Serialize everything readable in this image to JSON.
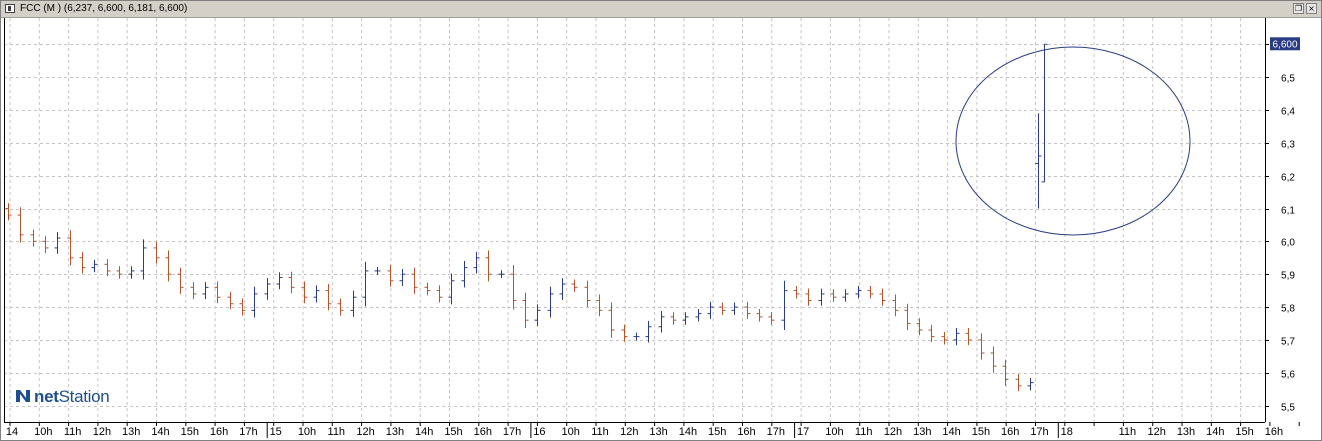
{
  "window": {
    "title": "FCC (M ) (6,237, 6,600, 6,181, 6,600)",
    "restore_glyph": "❐",
    "close_glyph": "×"
  },
  "logo": {
    "prefix": "net",
    "suffix": "Station",
    "icon": "netstation-logo-icon"
  },
  "colors": {
    "up": "#2a3d84",
    "down": "#b4562e",
    "grid": "#c4c4c4",
    "ellipse": "#2a3d84",
    "price_box": "#2a3d84"
  },
  "chart_data": {
    "type": "ohlc",
    "title": "",
    "xlabel": "",
    "ylabel": "",
    "ylim": [
      5.45,
      6.68
    ],
    "y_ticks": [
      "5,5",
      "5,6",
      "5,7",
      "5,8",
      "5,9",
      "6,0",
      "6,1",
      "6,2",
      "6,3",
      "6,4",
      "6,5",
      "6,6"
    ],
    "y_tick_values": [
      5.5,
      5.6,
      5.7,
      5.8,
      5.9,
      6.0,
      6.1,
      6.2,
      6.3,
      6.4,
      6.5,
      6.6
    ],
    "grid": true,
    "last_price_label": "6,600",
    "last_price": 6.6,
    "x_ticks": [
      {
        "label": "14",
        "day_start": true
      },
      {
        "label": "10h"
      },
      {
        "label": "11h"
      },
      {
        "label": "12h"
      },
      {
        "label": "13h"
      },
      {
        "label": "14h"
      },
      {
        "label": "15h"
      },
      {
        "label": "16h"
      },
      {
        "label": "17h"
      },
      {
        "label": "15",
        "day_start": true
      },
      {
        "label": "10h"
      },
      {
        "label": "11h"
      },
      {
        "label": "12h"
      },
      {
        "label": "13h"
      },
      {
        "label": "14h"
      },
      {
        "label": "15h"
      },
      {
        "label": "16h"
      },
      {
        "label": "17h"
      },
      {
        "label": "16",
        "day_start": true
      },
      {
        "label": "10h"
      },
      {
        "label": "11h"
      },
      {
        "label": "12h"
      },
      {
        "label": "13h"
      },
      {
        "label": "14h"
      },
      {
        "label": "15h"
      },
      {
        "label": "16h"
      },
      {
        "label": "17h"
      },
      {
        "label": "17",
        "day_start": true
      },
      {
        "label": "10h"
      },
      {
        "label": "11h"
      },
      {
        "label": "12h"
      },
      {
        "label": "13h"
      },
      {
        "label": "14h"
      },
      {
        "label": "15h"
      },
      {
        "label": "16h"
      },
      {
        "label": "17h"
      },
      {
        "label": "18",
        "day_start": true
      },
      {
        "label": ""
      },
      {
        "label": "11h"
      },
      {
        "label": "12h"
      },
      {
        "label": "13h"
      },
      {
        "label": "14h"
      },
      {
        "label": "15h"
      },
      {
        "label": "16h"
      },
      {
        "label": ""
      }
    ],
    "close_path": [
      6.08,
      6.02,
      6.0,
      5.98,
      6.01,
      5.95,
      5.92,
      5.93,
      5.91,
      5.9,
      5.91,
      5.98,
      5.95,
      5.9,
      5.86,
      5.84,
      5.86,
      5.83,
      5.81,
      5.79,
      5.84,
      5.87,
      5.89,
      5.86,
      5.83,
      5.85,
      5.81,
      5.79,
      5.83,
      5.91,
      5.91,
      5.88,
      5.9,
      5.86,
      5.85,
      5.83,
      5.88,
      5.92,
      5.95,
      5.9,
      5.9,
      5.82,
      5.76,
      5.79,
      5.84,
      5.87,
      5.86,
      5.82,
      5.79,
      5.73,
      5.71,
      5.71,
      5.74,
      5.77,
      5.76,
      5.77,
      5.78,
      5.8,
      5.79,
      5.8,
      5.78,
      5.77,
      5.76,
      5.85,
      5.84,
      5.82,
      5.84,
      5.83,
      5.84,
      5.85,
      5.84,
      5.82,
      5.79,
      5.75,
      5.73,
      5.71,
      5.7,
      5.72,
      5.7,
      5.66,
      5.62,
      5.58,
      5.56,
      5.57
    ],
    "session_18_bars": [
      {
        "open": 6.237,
        "high": 6.39,
        "low": 6.1,
        "close": 6.26
      },
      {
        "open": 6.181,
        "high": 6.6,
        "low": 6.181,
        "close": 6.6
      }
    ],
    "annotation": "ellipse around the day-18 session bars"
  }
}
